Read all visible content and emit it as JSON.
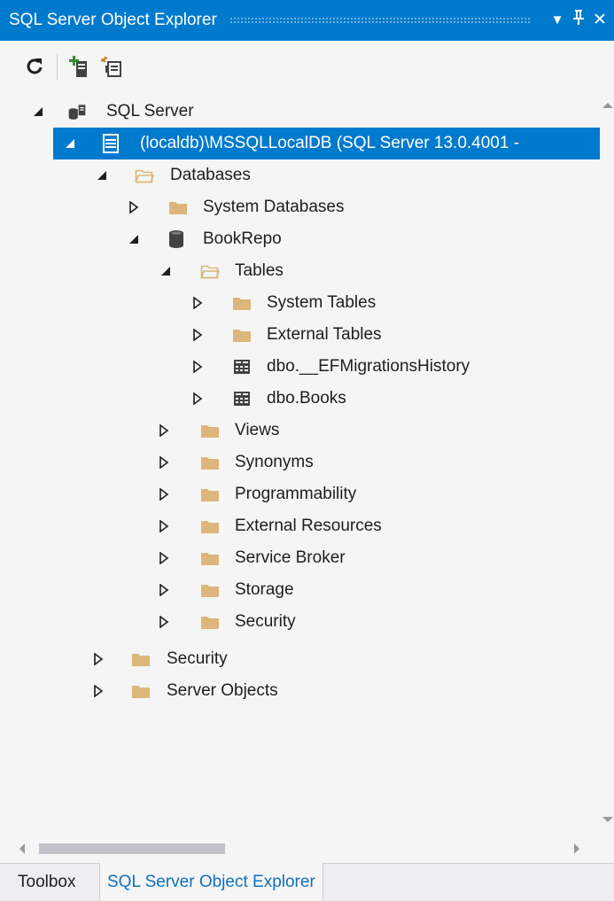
{
  "window": {
    "title": "SQL Server Object Explorer",
    "dropdown_glyph": "▼",
    "pin_glyph": "🖈",
    "close_glyph": "✕"
  },
  "toolbar": {
    "refresh_icon": "refresh-icon",
    "add_server_icon": "add-sql-server-icon",
    "new_query_icon": "new-query-icon"
  },
  "tree": [
    {
      "label": "SQL Server",
      "icon": "sql-server-icon",
      "expanded": true
    },
    {
      "label": "(localdb)\\MSSQLLocalDB (SQL Server 13.0.4001 - ",
      "icon": "server-instance-icon",
      "expanded": true,
      "selected": true
    },
    {
      "label": "Databases",
      "icon": "folder-open-icon",
      "expanded": true
    },
    {
      "label": "System Databases",
      "icon": "folder-icon",
      "expanded": false
    },
    {
      "label": "BookRepo",
      "icon": "database-icon",
      "expanded": true
    },
    {
      "label": "Tables",
      "icon": "folder-open-icon",
      "expanded": true
    },
    {
      "label": "System Tables",
      "icon": "folder-icon",
      "expanded": false
    },
    {
      "label": "External Tables",
      "icon": "folder-icon",
      "expanded": false
    },
    {
      "label": "dbo.__EFMigrationsHistory",
      "icon": "table-icon",
      "expanded": false
    },
    {
      "label": "dbo.Books",
      "icon": "table-icon",
      "expanded": false
    },
    {
      "label": "Views",
      "icon": "folder-icon",
      "expanded": false
    },
    {
      "label": "Synonyms",
      "icon": "folder-icon",
      "expanded": false
    },
    {
      "label": "Programmability",
      "icon": "folder-icon",
      "expanded": false
    },
    {
      "label": "External Resources",
      "icon": "folder-icon",
      "expanded": false
    },
    {
      "label": "Service Broker",
      "icon": "folder-icon",
      "expanded": false
    },
    {
      "label": "Storage",
      "icon": "folder-icon",
      "expanded": false
    },
    {
      "label": "Security",
      "icon": "folder-icon",
      "expanded": false
    },
    {
      "label": "Security",
      "icon": "folder-icon",
      "expanded": false
    },
    {
      "label": "Server Objects",
      "icon": "folder-icon",
      "expanded": false
    }
  ],
  "tabs": [
    {
      "label": "Toolbox",
      "active": false
    },
    {
      "label": "SQL Server Object Explorer",
      "active": true
    }
  ],
  "colors": {
    "accent": "#007acc",
    "folder": "#dcb67a",
    "background": "#f5f5f5",
    "active_tab_text": "#0e70c0"
  }
}
